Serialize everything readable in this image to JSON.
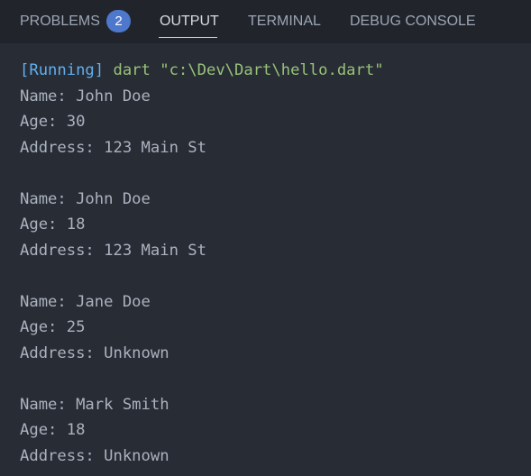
{
  "tabs": {
    "problems": "PROBLEMS",
    "problems_count": "2",
    "output": "OUTPUT",
    "terminal": "TERMINAL",
    "debug_console": "DEBUG CONSOLE",
    "active": "OUTPUT"
  },
  "run": {
    "tag": "[Running]",
    "command": " dart \"c:\\Dev\\Dart\\hello.dart\""
  },
  "records": [
    {
      "name": "Name: John Doe",
      "age": "Age: 30",
      "address": "Address: 123 Main St"
    },
    {
      "name": "Name: John Doe",
      "age": "Age: 18",
      "address": "Address: 123 Main St"
    },
    {
      "name": "Name: Jane Doe",
      "age": "Age: 25",
      "address": "Address: Unknown"
    },
    {
      "name": "Name: Mark Smith",
      "age": "Age: 18",
      "address": "Address: Unknown"
    }
  ],
  "colors": {
    "background": "#282c34",
    "tab_bar": "#21252b",
    "text": "#abb2bf",
    "running_tag": "#61afef",
    "running_command": "#98c379",
    "badge": "#4d78cc"
  }
}
